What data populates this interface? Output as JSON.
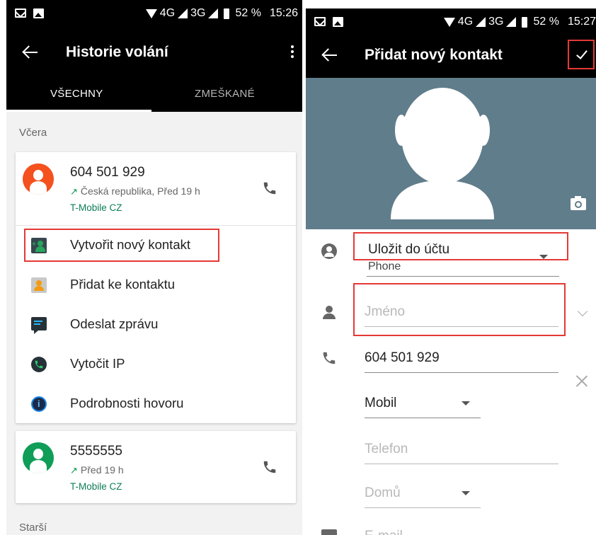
{
  "left_screen": {
    "status": {
      "network": "4G",
      "network2": "3G",
      "battery": "52 %",
      "time": "15:26"
    },
    "title": "Historie volání",
    "tabs": [
      {
        "label": "VŠECHNY"
      },
      {
        "label": "ZMEŠKANÉ"
      }
    ],
    "section_yesterday": "Včera",
    "section_older": "Starší",
    "call1": {
      "number": "604 501 929",
      "direction_icon": "↗",
      "detail": "Česká republika, Před 19 h",
      "carrier": "T-Mobile CZ",
      "avatar_color": "#f4511e"
    },
    "actions": [
      {
        "label": "Vytvořit nový kontakt",
        "icon": "add-contact-icon"
      },
      {
        "label": "Přidat ke kontaktu",
        "icon": "contact-card-icon"
      },
      {
        "label": "Odeslat zprávu",
        "icon": "message-icon"
      },
      {
        "label": "Vytočit IP",
        "icon": "ip-call-icon"
      },
      {
        "label": "Podrobnosti hovoru",
        "icon": "info-icon"
      }
    ],
    "call2": {
      "number": "5555555",
      "direction_icon": "↗",
      "detail": "Před 19 h",
      "carrier": "T-Mobile CZ",
      "avatar_color": "#0f9d58"
    }
  },
  "right_screen": {
    "status": {
      "network": "4G",
      "network2": "3G",
      "battery": "52 %",
      "time": "15:27"
    },
    "title": "Přidat nový kontakt",
    "header_color": "#607d8b",
    "account_label": "Uložit do účtu",
    "account_value": "Phone",
    "name_placeholder": "Jméno",
    "phone_value": "604 501 929",
    "phone_type": "Mobil",
    "phone2_placeholder": "Telefon",
    "phone2_type": "Domů",
    "email_placeholder": "E-mail"
  },
  "colors": {
    "highlight": "#e53935",
    "accent_green": "#0d7d54"
  }
}
